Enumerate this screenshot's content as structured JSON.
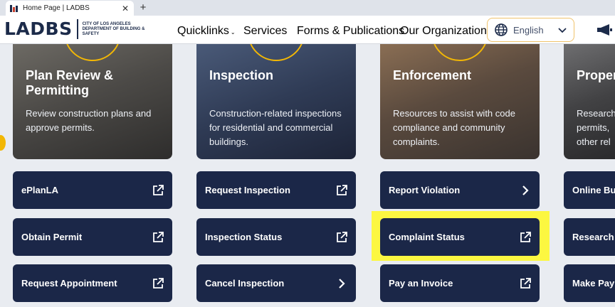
{
  "browser": {
    "tab_title": "Home Page | LADBS",
    "close_glyph": "✕",
    "new_tab_glyph": "+"
  },
  "header": {
    "logo_text": "LADBS",
    "logo_subtext": "CITY OF LOS ANGELES DEPARTMENT OF BUILDING & SAFETY",
    "nav": {
      "quicklinks": "Quicklinks",
      "services": "Services",
      "forms": "Forms & Publications",
      "organization": "Our Organization"
    },
    "language": "English"
  },
  "cards": [
    {
      "title": "Plan Review & Permitting",
      "description": "Review construction plans and approve permits."
    },
    {
      "title": "Inspection",
      "description": "Construction-related inspections for residential and commercial buildings."
    },
    {
      "title": "Enforcement",
      "description": "Resources to assist with code compliance and community complaints."
    },
    {
      "title": "Proper",
      "description": "Research permits, other rel"
    }
  ],
  "buttons": {
    "col1": [
      "ePlanLA",
      "Obtain Permit",
      "Request Appointment"
    ],
    "col2": [
      "Request Inspection",
      "Inspection Status",
      "Cancel Inspection"
    ],
    "col3": [
      "Report Violation",
      "Complaint Status",
      "Pay an Invoice"
    ],
    "col4": [
      "Online Bu",
      "Research",
      "Make Pay"
    ]
  },
  "colors": {
    "navy": "#1b2748",
    "accent_yellow": "#f2b705",
    "highlight": "#fcf741",
    "logo_red": "#c8402e"
  }
}
